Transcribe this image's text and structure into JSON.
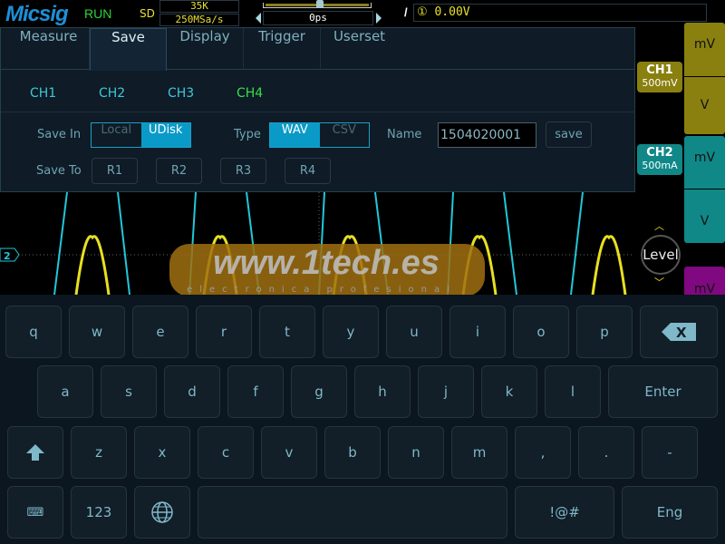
{
  "topbar": {
    "brand": "Micsig",
    "status": "RUN",
    "mode": "SD",
    "memory_depth": "35K",
    "sample_rate": "250MSa/s",
    "time_offset": "0ps",
    "trigger_source_icon": "channel-1-circle",
    "trigger_level": "① 0.00V"
  },
  "tabs": [
    {
      "label": "Measure"
    },
    {
      "label": "Save",
      "selected": true
    },
    {
      "label": "Display"
    },
    {
      "label": "Trigger"
    },
    {
      "label": "Userset"
    }
  ],
  "channels": [
    {
      "label": "CH1"
    },
    {
      "label": "CH2"
    },
    {
      "label": "CH3"
    },
    {
      "label": "CH4",
      "selected": true
    }
  ],
  "save": {
    "save_in_label": "Save In",
    "save_in_options": [
      "Local",
      "UDisk"
    ],
    "save_in_selected": "UDisk",
    "type_label": "Type",
    "type_options": [
      "WAV",
      "CSV"
    ],
    "type_selected": "WAV",
    "name_label": "Name",
    "name_value": "1504020001",
    "save_button": "save",
    "save_to_label": "Save To",
    "save_to_options": [
      "R1",
      "R2",
      "R3",
      "R4"
    ]
  },
  "right": {
    "ch1": {
      "label": "CH1",
      "scale": "500mV"
    },
    "ch2": {
      "label": "CH2",
      "scale": "500mA"
    },
    "ch1_units": [
      "mV",
      "V"
    ],
    "ch2_units": [
      "mV",
      "V"
    ],
    "ch3_units": [
      "mV"
    ],
    "level": "Level"
  },
  "marker": "2",
  "watermark": {
    "text": "www.1tech.es",
    "sub": "electronica profesional"
  },
  "keyboard": {
    "row1": [
      "q",
      "w",
      "e",
      "r",
      "t",
      "y",
      "u",
      "i",
      "o",
      "p"
    ],
    "row2": [
      "a",
      "s",
      "d",
      "f",
      "g",
      "h",
      "j",
      "k",
      "l"
    ],
    "enter": "Enter",
    "row3": [
      "z",
      "x",
      "c",
      "v",
      "b",
      "n",
      "m",
      ",",
      ".",
      "-"
    ],
    "numbers": "123",
    "symbols": "!@#",
    "language": "Eng"
  },
  "colors": {
    "ch1": "#e8e020",
    "ch2": "#20c8d8",
    "ch3": "#8a0a8a",
    "accent": "#0a9ac8"
  }
}
